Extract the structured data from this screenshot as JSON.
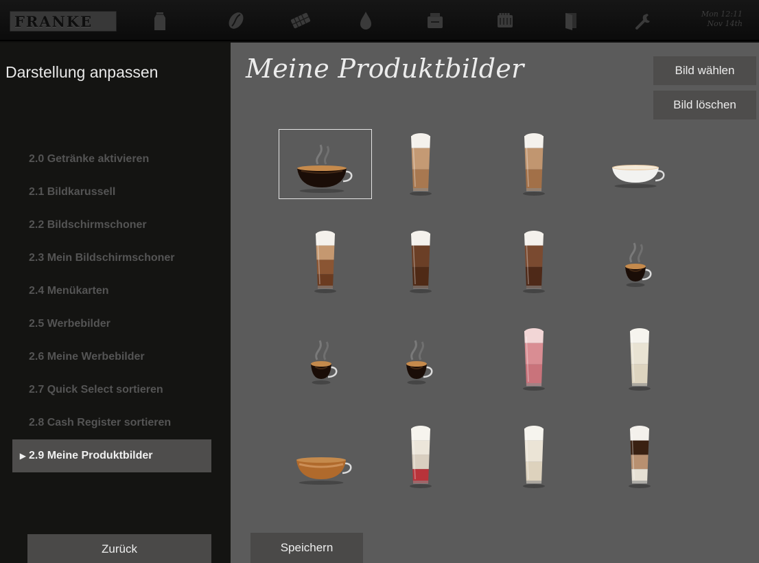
{
  "header": {
    "logo": "FRANKE",
    "datetime_line1": "Mon 12:11",
    "datetime_line2": "Nov 14th",
    "icons": [
      "milk-icon",
      "coffee-bean-icon",
      "chocolate-icon",
      "water-drop-icon",
      "cleaning-icon",
      "cup-stack-icon",
      "door-icon",
      "wrench-icon"
    ]
  },
  "sidebar": {
    "title": "Darstellung anpassen",
    "items": [
      {
        "label": "2.0 Getränke aktivieren",
        "active": false
      },
      {
        "label": "2.1 Bildkarussell",
        "active": false
      },
      {
        "label": "2.2 Bildschirmschoner",
        "active": false
      },
      {
        "label": "2.3 Mein Bildschirmschoner",
        "active": false
      },
      {
        "label": "2.4 Menükarten",
        "active": false
      },
      {
        "label": "2.5 Werbebilder",
        "active": false
      },
      {
        "label": "2.6 Meine Werbebilder",
        "active": false
      },
      {
        "label": "2.7 Quick Select sortieren",
        "active": false
      },
      {
        "label": "2.8 Cash Register sortieren",
        "active": false
      },
      {
        "label": "2.9 Meine Produktbilder",
        "active": true
      }
    ],
    "back_label": "Zurück"
  },
  "main": {
    "title": "Meine Produktbilder",
    "choose_label": "Bild wählen",
    "delete_label": "Bild löschen",
    "save_label": "Speichern",
    "selected_index": 0,
    "products": [
      {
        "type": "cup",
        "name": "espresso-cup-image",
        "steam": true
      },
      {
        "type": "glass",
        "name": "latte-glass-image",
        "layers": [
          "#f4f1ec",
          "#c49a74",
          "#a87850"
        ]
      },
      {
        "type": "glass",
        "name": "latte-glass-image",
        "layers": [
          "#f4f1ec",
          "#c19670",
          "#a27048"
        ]
      },
      {
        "type": "cup",
        "name": "cappuccino-cup-image",
        "white": true
      },
      {
        "type": "glass",
        "name": "layered-latte-glass-image",
        "layers": [
          "#f4f1ec",
          "#c59870",
          "#8a5533",
          "#6b3b20"
        ]
      },
      {
        "type": "glass",
        "name": "hot-chocolate-glass-image",
        "layers": [
          "#f4f1ec",
          "#6b3f26",
          "#4f2a16"
        ]
      },
      {
        "type": "glass",
        "name": "hot-chocolate-glass-image",
        "layers": [
          "#f4f1ec",
          "#7a4a30",
          "#4e2918"
        ]
      },
      {
        "type": "cup",
        "name": "espresso-cup-image",
        "steam": true,
        "small": true
      },
      {
        "type": "cup",
        "name": "espresso-cup-image",
        "steam": true,
        "small": true
      },
      {
        "type": "cup",
        "name": "espresso-cup-image",
        "steam": true,
        "small": true
      },
      {
        "type": "glass",
        "name": "strawberry-shake-glass-image",
        "layers": [
          "#f2d6d6",
          "#d98d93",
          "#c9737b"
        ]
      },
      {
        "type": "glass",
        "name": "milk-glass-image",
        "layers": [
          "#f6f4ee",
          "#e9e3d3",
          "#ddd4bf"
        ]
      },
      {
        "type": "cup",
        "name": "cafe-creme-cup-image",
        "crema": true
      },
      {
        "type": "glass",
        "name": "latte-syrup-glass-image",
        "layers": [
          "#f6f4ee",
          "#ece6da",
          "#d9cfc0",
          "#b8333a"
        ]
      },
      {
        "type": "glass",
        "name": "milk-glass-image",
        "layers": [
          "#f6f4ee",
          "#ebe4d6",
          "#ddd2bd"
        ]
      },
      {
        "type": "glass",
        "name": "latte-macchiato-glass-image",
        "layers": [
          "#f4f1ec",
          "#3a2112",
          "#b89070",
          "#e6e0d4"
        ]
      }
    ]
  }
}
